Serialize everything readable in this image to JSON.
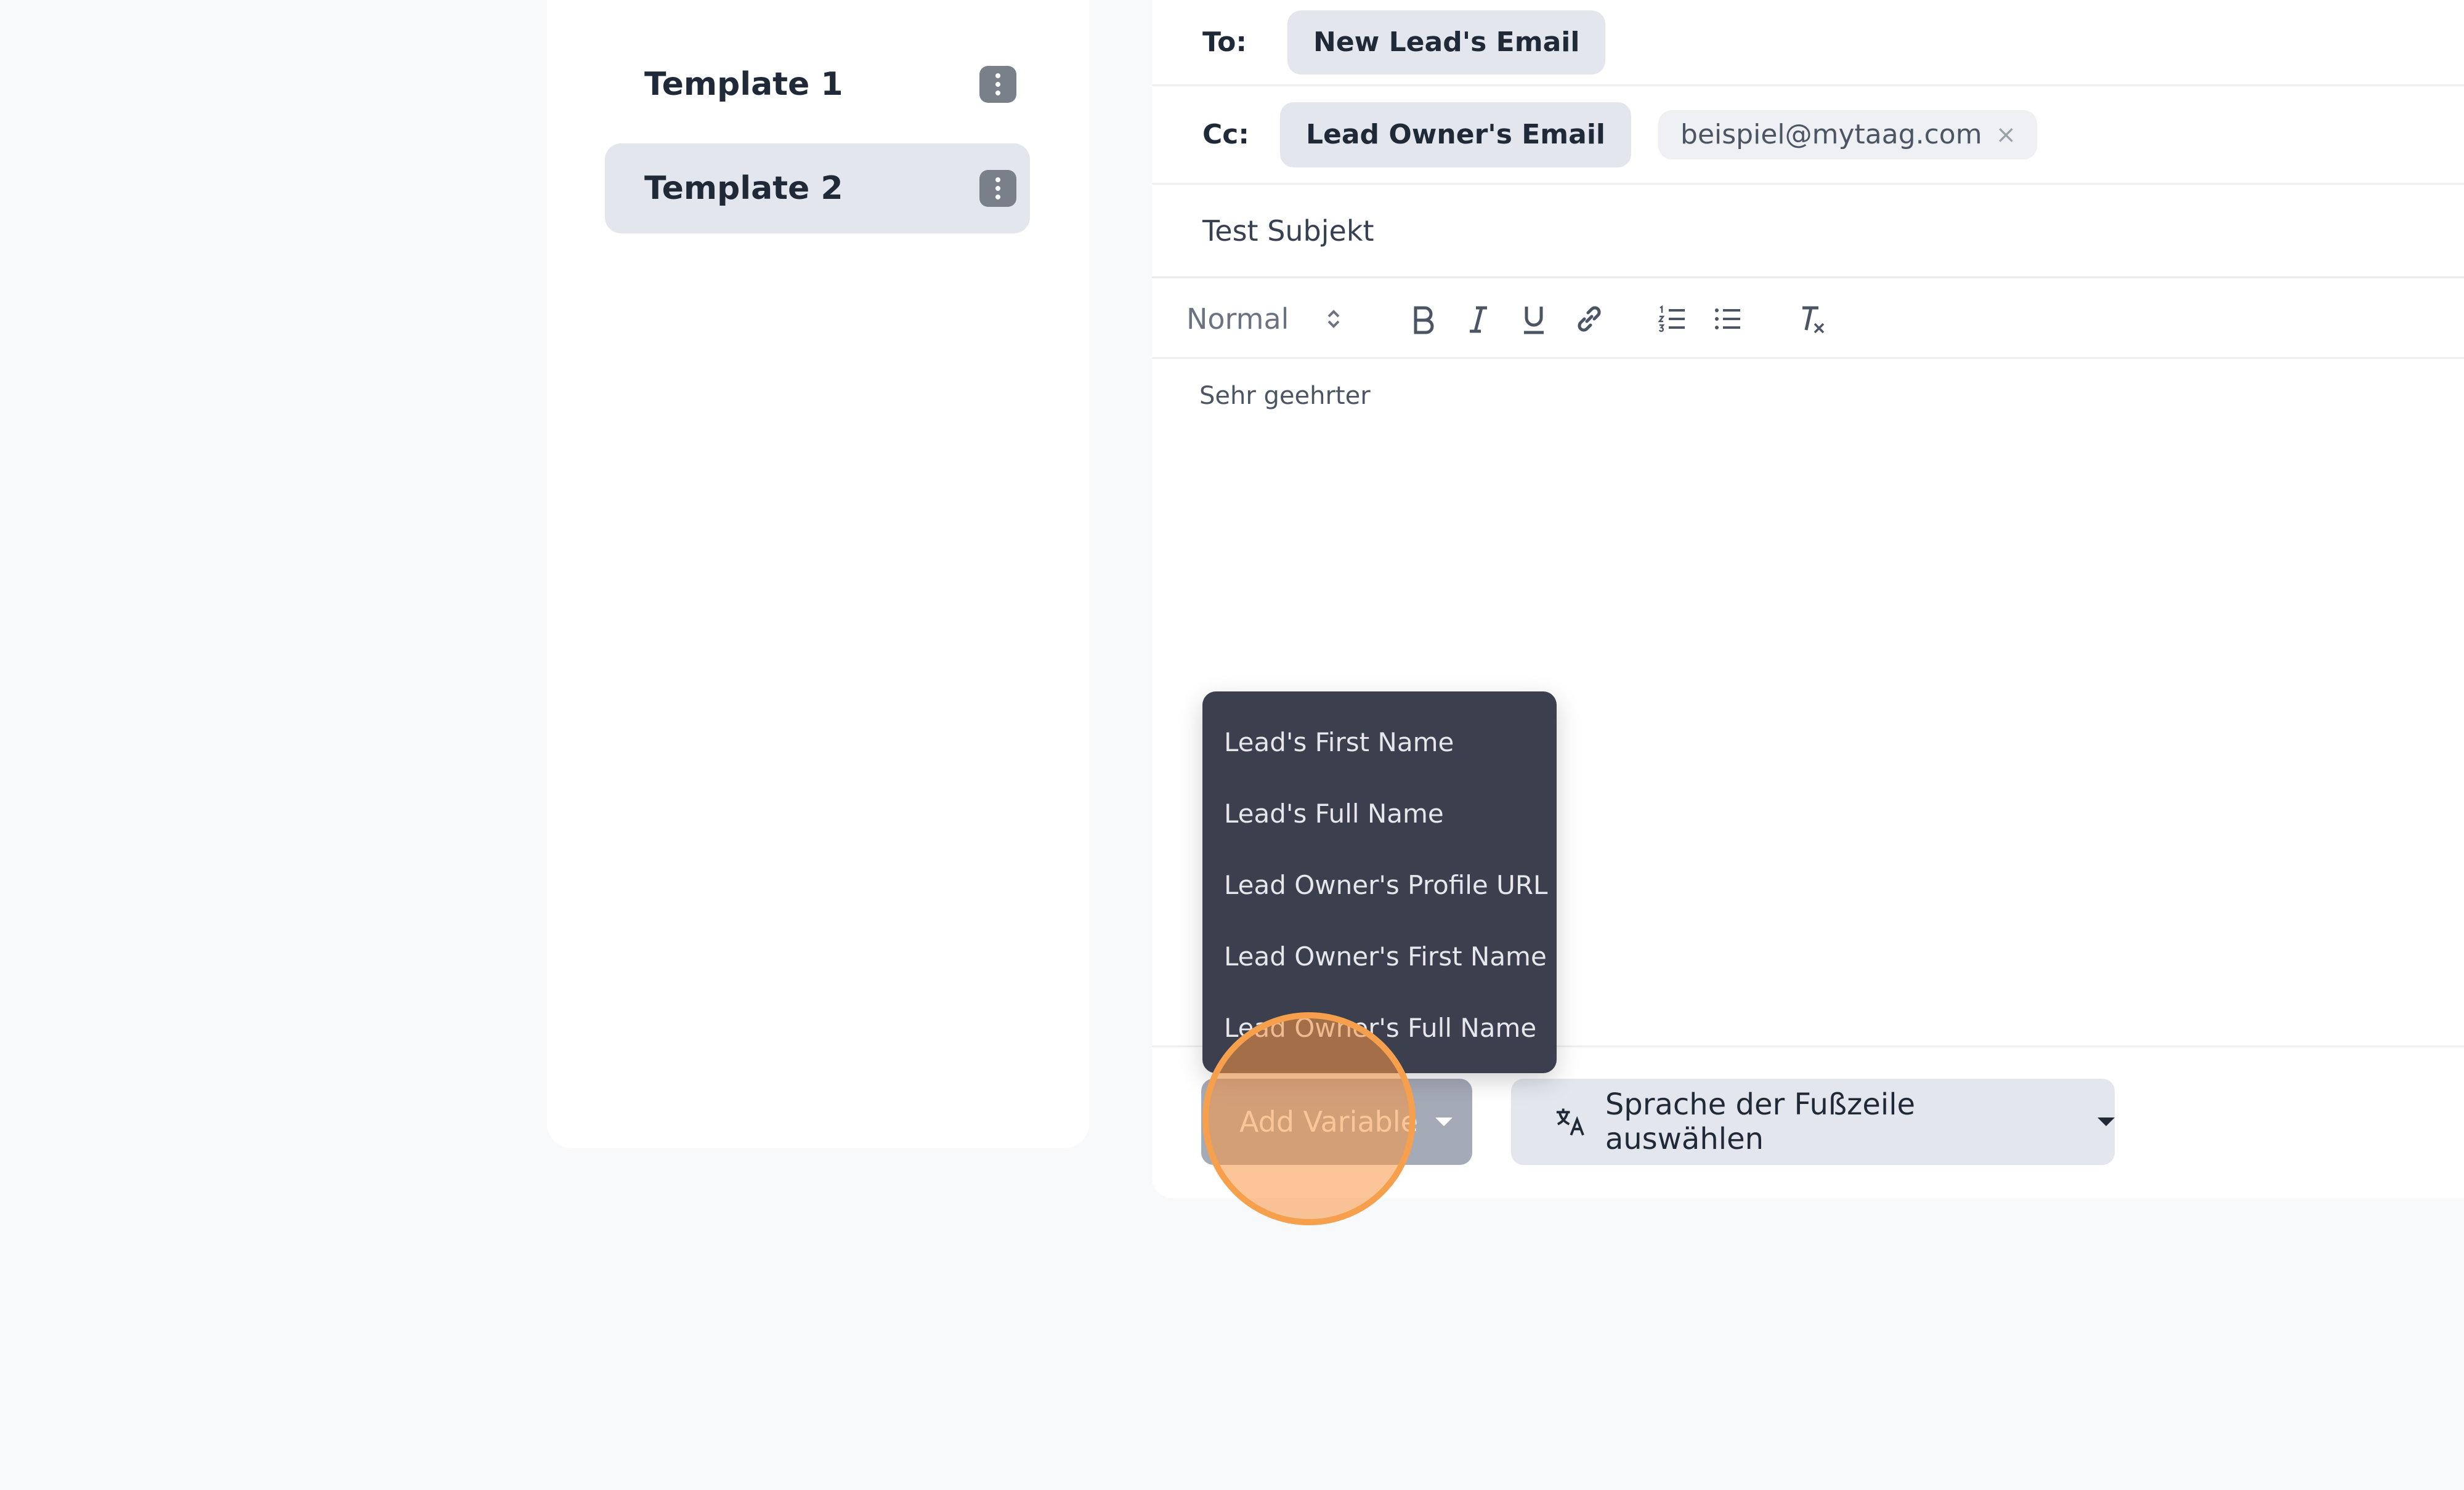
{
  "templates": {
    "items": [
      {
        "label": "Template 1",
        "active": false
      },
      {
        "label": "Template 2",
        "active": true
      }
    ]
  },
  "composer": {
    "to_label": "To:",
    "to_chip": "New Lead's Email",
    "cc_label": "Cc:",
    "cc_chip": "Lead Owner's Email",
    "cc_tag": "beispiel@mytaag.com",
    "cc_tag_remove": "×",
    "subject": "Test Subjekt",
    "toolbar": {
      "format_value": "Normal",
      "icons": [
        "bold-icon",
        "italic-icon",
        "underline-icon",
        "link-icon",
        "ordered-list-icon",
        "bullet-list-icon",
        "clear-format-icon"
      ]
    },
    "body": "Sehr geehrter",
    "add_variable_label": "Add Variable",
    "footer_lang_label": "Sprache der Fußzeile auswählen"
  },
  "variable_menu": {
    "items": [
      "Lead's First Name",
      "Lead's Full Name",
      "Lead Owner's Profile URL",
      "Lead Owner's First Name",
      "Lead Owner's Full Name"
    ]
  },
  "colors": {
    "menu_bg": "#3c3f4e",
    "chip_bg": "#e3e6ed",
    "highlight": "#f6a04d"
  }
}
